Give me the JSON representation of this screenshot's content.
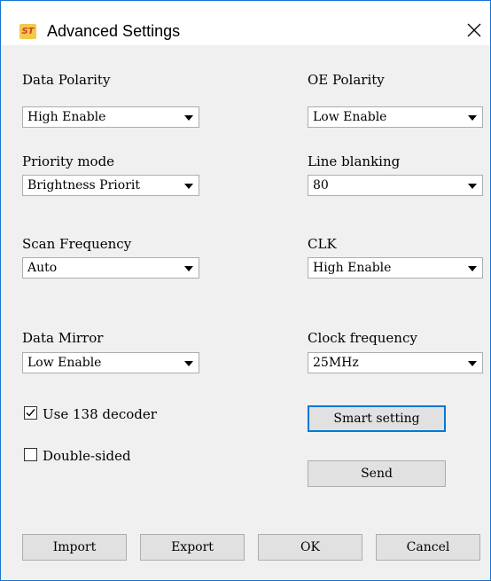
{
  "window": {
    "title": "Advanced Settings"
  },
  "fields": {
    "data_polarity": {
      "label": "Data Polarity",
      "value": "High Enable"
    },
    "oe_polarity": {
      "label": "OE Polarity",
      "value": "Low Enable"
    },
    "priority_mode": {
      "label": "Priority mode",
      "value": "Brightness Priorit"
    },
    "line_blanking": {
      "label": "Line blanking",
      "value": "80"
    },
    "scan_frequency": {
      "label": "Scan Frequency",
      "value": "Auto"
    },
    "clk": {
      "label": "CLK",
      "value": "High Enable"
    },
    "data_mirror": {
      "label": "Data Mirror",
      "value": "Low Enable"
    },
    "clock_frequency": {
      "label": "Clock frequency",
      "value": "25MHz"
    }
  },
  "checkboxes": {
    "use138": {
      "label": "Use 138 decoder",
      "checked": true
    },
    "double_sided": {
      "label": "Double-sided",
      "checked": false
    }
  },
  "buttons": {
    "smart_setting": "Smart setting",
    "send": "Send",
    "import": "Import",
    "export": "Export",
    "ok": "OK",
    "cancel": "Cancel"
  },
  "icons": {
    "app": "app-logo-icon",
    "close": "close-icon",
    "checkmark": "checkmark-icon",
    "dropdown": "chevron-down-icon"
  },
  "colors": {
    "window_border": "#1874d0",
    "dialog_bg": "#f0f0f0",
    "default_button_border": "#0078d7",
    "app_icon_bg": "#f2c94c"
  }
}
